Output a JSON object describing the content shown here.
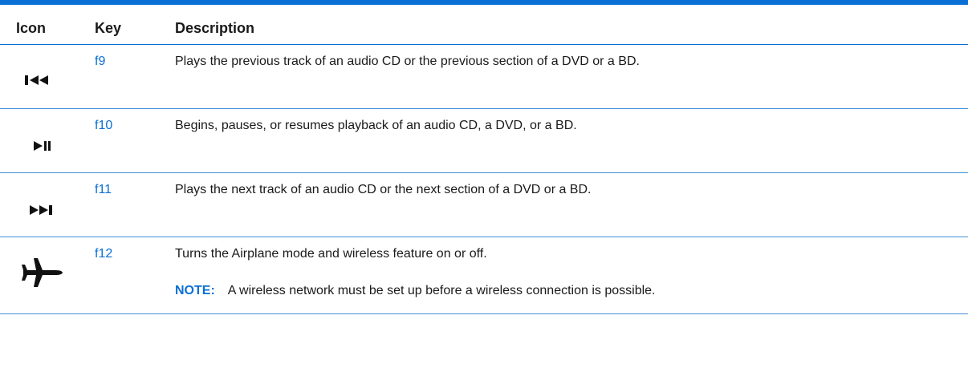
{
  "header": {
    "icon_label": "Icon",
    "key_label": "Key",
    "description_label": "Description"
  },
  "rows": [
    {
      "icon": "previous-track-icon",
      "key": "f9",
      "description": "Plays the previous track of an audio CD or the previous section of a DVD or a BD."
    },
    {
      "icon": "play-pause-icon",
      "key": "f10",
      "description": "Begins, pauses, or resumes playback of an audio CD, a DVD, or a BD."
    },
    {
      "icon": "next-track-icon",
      "key": "f11",
      "description": "Plays the next track of an audio CD or the next section of a DVD or a BD."
    },
    {
      "icon": "airplane-icon",
      "key": "f12",
      "description": "Turns the Airplane mode and wireless feature on or off.",
      "note_label": "NOTE:",
      "note_text": "A wireless network must be set up before a wireless connection is possible."
    }
  ],
  "colors": {
    "accent": "#0a6fd4",
    "text": "#1a1a1a"
  }
}
